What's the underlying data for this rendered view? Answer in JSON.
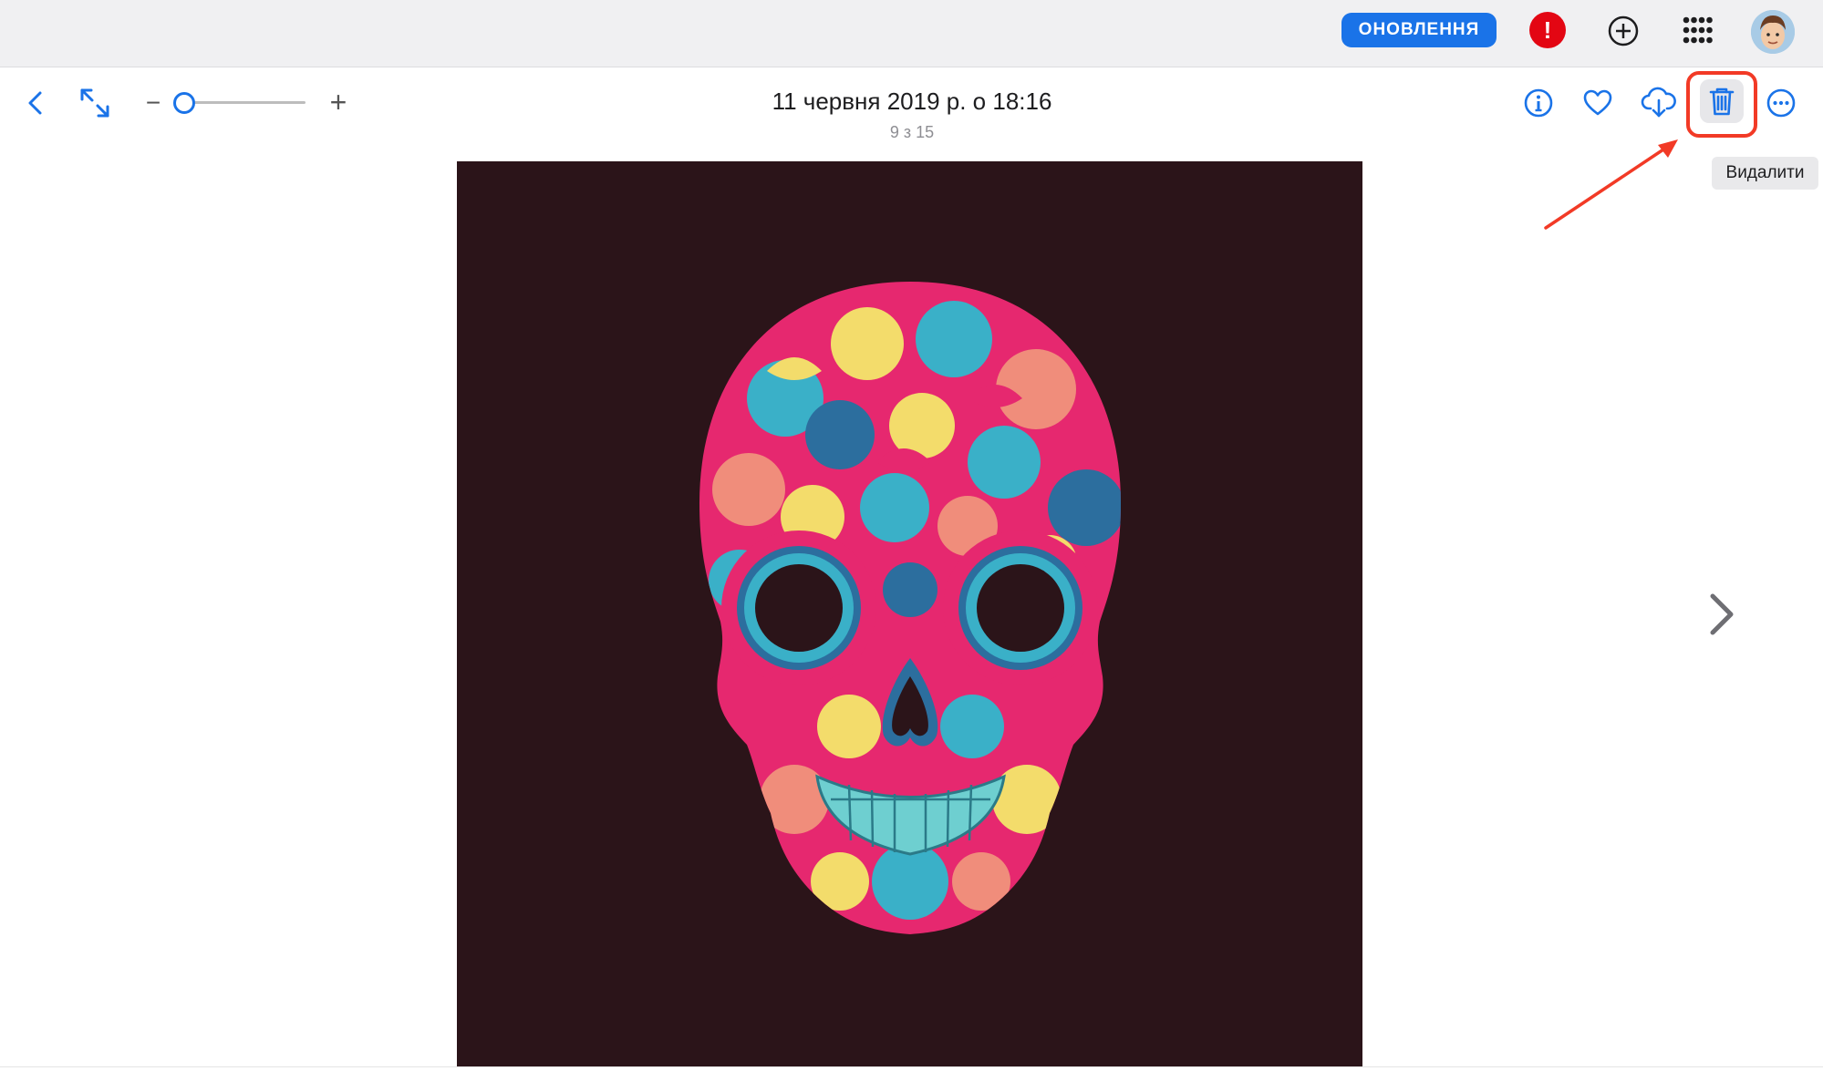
{
  "topbar": {
    "update_label": "ОНОВЛЕННЯ",
    "alert_glyph": "!",
    "icons": [
      "alert-icon",
      "add-circle-icon",
      "apps-grid-icon",
      "avatar"
    ]
  },
  "viewer": {
    "title": "11 червня 2019 р. о 18:16",
    "position": "9 з 15",
    "zoom_minus": "−",
    "zoom_plus": "+",
    "zoom_level": 0.05,
    "toolbar_icons": [
      "back-icon",
      "fullscreen-icon",
      "info-icon",
      "heart-icon",
      "cloud-download-icon",
      "trash-icon",
      "more-icon"
    ],
    "delete_tooltip": "Видалити",
    "next_icon": "chevron-right-icon"
  },
  "colors": {
    "accent": "#1a73e8",
    "alert": "#e30613",
    "highlight": "#f23a26",
    "photo_bg": "#2b1419",
    "skull_pink": "#e6286f",
    "skull_teal": "#3ab0c8",
    "skull_yellow": "#f3dc6b",
    "skull_salmon": "#f08d7b",
    "skull_blue": "#2c6e9e"
  }
}
